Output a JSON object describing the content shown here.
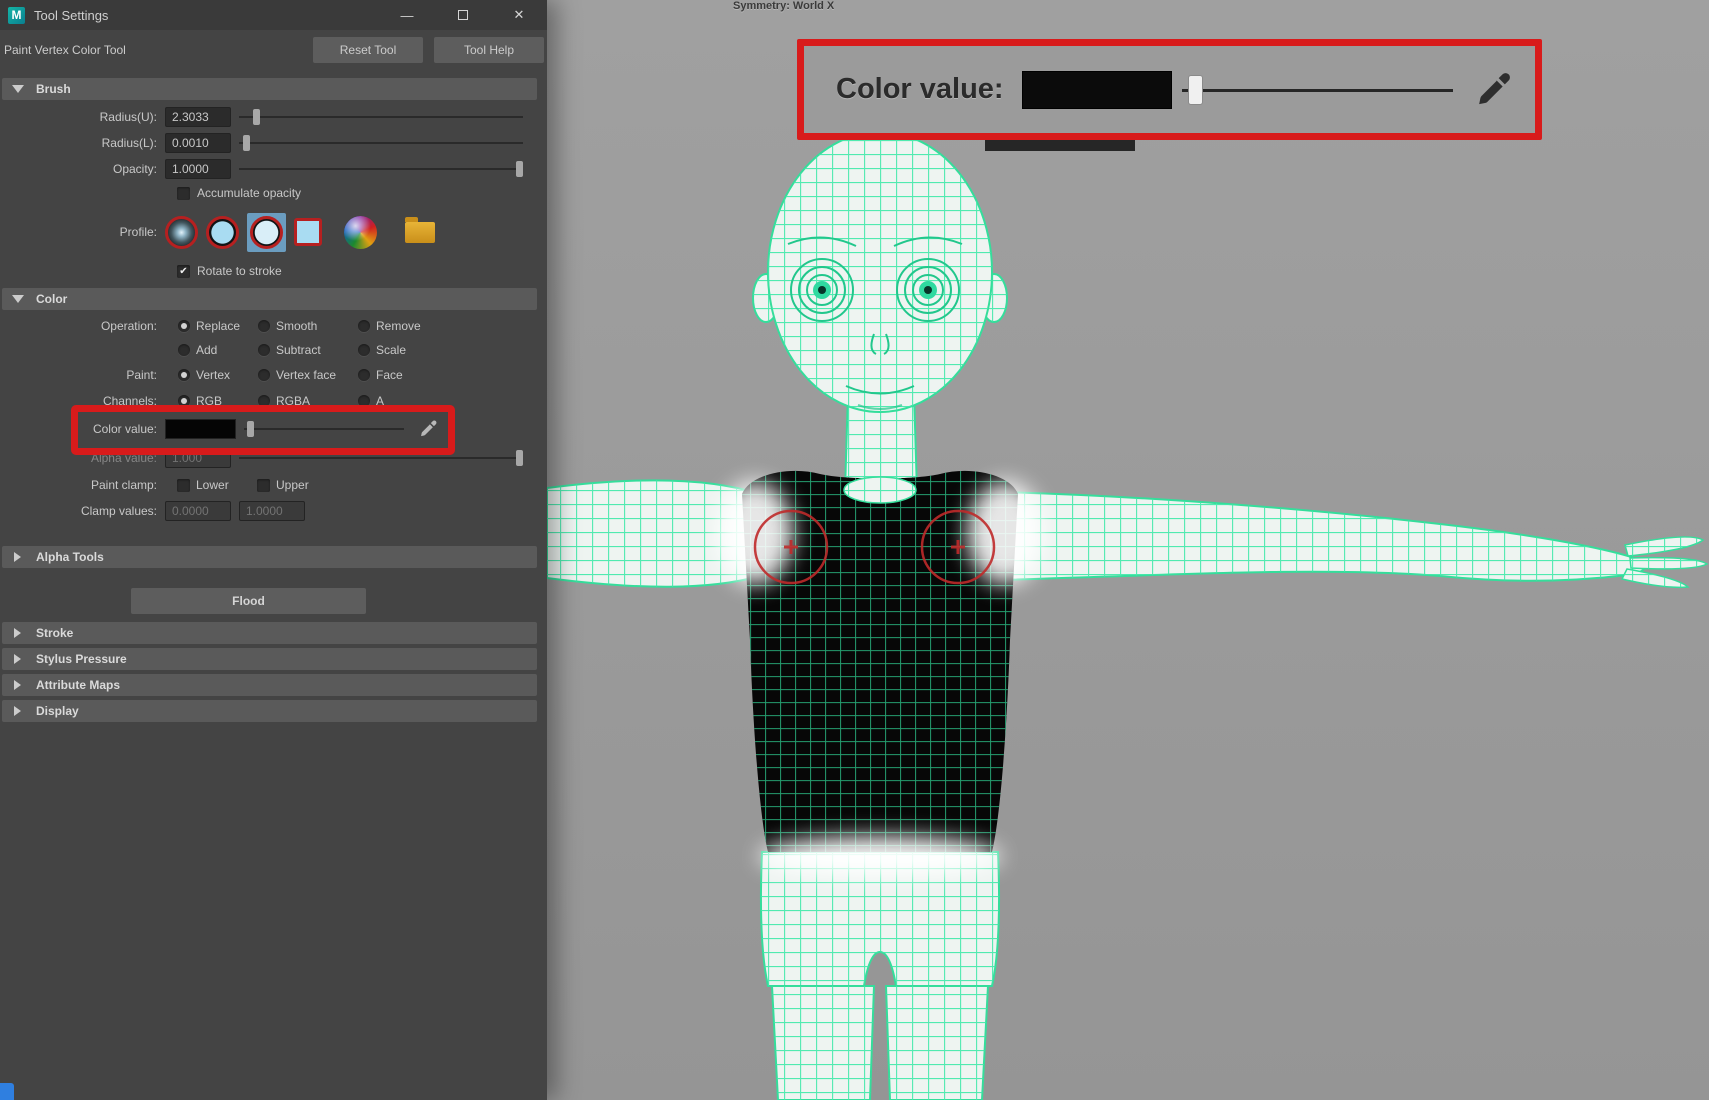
{
  "window": {
    "app_icon": "M",
    "title": "Tool Settings",
    "minimize": "—",
    "close": "✕"
  },
  "toolbar": {
    "tool_name": "Paint Vertex Color Tool",
    "reset_label": "Reset Tool",
    "help_label": "Tool Help"
  },
  "brush": {
    "header": "Brush",
    "radius_u": {
      "label": "Radius(U):",
      "value": "2.3033"
    },
    "radius_l": {
      "label": "Radius(L):",
      "value": "0.0010"
    },
    "opacity": {
      "label": "Opacity:",
      "value": "1.0000"
    },
    "accumulate_label": "Accumulate opacity",
    "profile_label": "Profile:",
    "rotate_label": "Rotate to stroke"
  },
  "color": {
    "header": "Color",
    "operation_label": "Operation:",
    "operations": [
      {
        "label": "Replace",
        "selected": true
      },
      {
        "label": "Smooth",
        "selected": false
      },
      {
        "label": "Remove",
        "selected": false
      },
      {
        "label": "Add",
        "selected": false
      },
      {
        "label": "Subtract",
        "selected": false
      },
      {
        "label": "Scale",
        "selected": false
      }
    ],
    "paint_label": "Paint:",
    "paint_options": [
      {
        "label": "Vertex",
        "selected": true
      },
      {
        "label": "Vertex face",
        "selected": false
      },
      {
        "label": "Face",
        "selected": false
      }
    ],
    "channels_label": "Channels:",
    "channel_options": [
      {
        "label": "RGB",
        "selected": true
      },
      {
        "label": "RGBA",
        "selected": false
      },
      {
        "label": "A",
        "selected": false
      }
    ],
    "color_value_label": "Color value:",
    "color_value_swatch": "#000000",
    "alpha_value_label": "Alpha value:",
    "alpha_value": "1.000",
    "paint_clamp_label": "Paint clamp:",
    "clamp_lower_label": "Lower",
    "clamp_upper_label": "Upper",
    "clamp_values_label": "Clamp values:",
    "clamp_min": "0.0000",
    "clamp_max": "1.0000"
  },
  "sections": {
    "alpha_tools": "Alpha Tools",
    "flood_label": "Flood",
    "stroke": "Stroke",
    "stylus_pressure": "Stylus Pressure",
    "attribute_maps": "Attribute Maps",
    "display": "Display"
  },
  "viewport": {
    "symmetry_label": "Symmetry: World X",
    "callout_color_value_label": "Color value:"
  },
  "colors": {
    "highlight_red": "#d81b1b",
    "wireframe_green": "#3fe9a9",
    "panel_bg": "#444444",
    "swatch_black": "#000000",
    "viewport_gray": "#9b9b9b"
  }
}
